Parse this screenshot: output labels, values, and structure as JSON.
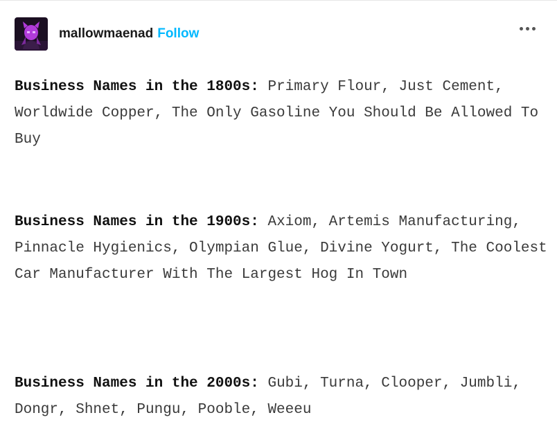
{
  "post": {
    "author": "mallowmaenad",
    "follow_label": "Follow",
    "more_menu_icon": "more-icon",
    "avatar_icon": "avatar-image",
    "colors": {
      "follow": "#00b8ff",
      "text": "#3a3a3a",
      "bold_text": "#111111"
    }
  },
  "paragraphs": [
    {
      "label": "Business Names in the 1800s:",
      "text": " Primary Flour, Just Cement, Worldwide Copper, The Only Gasoline You Should Be Allowed To Buy"
    },
    {
      "label": "Business Names in the 1900s:",
      "text": " Axiom, Artemis Manufacturing, Pinnacle Hygienics, Olympian Glue, Divine Yogurt, The Coolest Car Manufacturer With The Largest Hog In Town"
    },
    {
      "label": "Business Names in the 2000s:",
      "text": " Gubi, Turna, Clooper, Jumbli, Dongr, Shnet, Pungu, Pooble, Weeeu"
    }
  ]
}
